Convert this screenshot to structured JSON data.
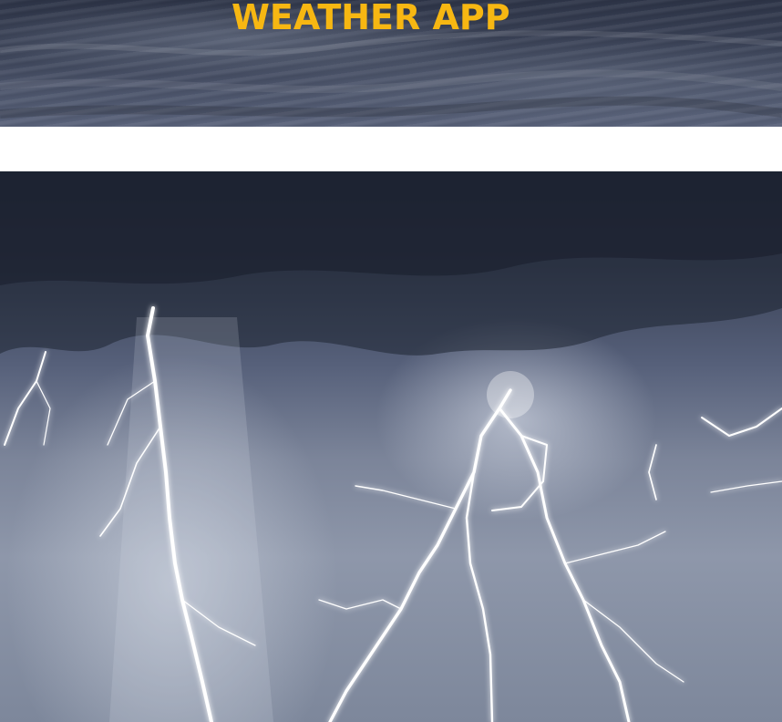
{
  "app": {
    "title": "WEATHER APP"
  },
  "hero_image": {
    "subject": "thunderstorm-lightning"
  },
  "colors": {
    "title": "#f7b712",
    "sky_dark": "#2e3548",
    "sky_light": "#8e97aa",
    "lightning": "#ffffff"
  }
}
